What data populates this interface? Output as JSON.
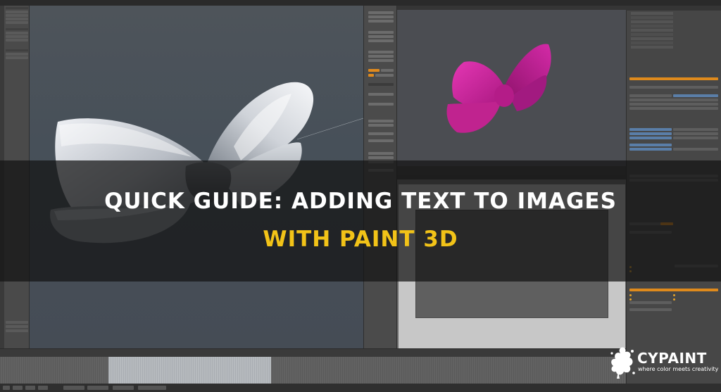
{
  "title": {
    "line1": "QUICK GUIDE: ADDING TEXT TO IMAGES",
    "line2": "WITH PAINT 3D"
  },
  "logo": {
    "name": "CYPAINT",
    "tagline": "where color meets creativity"
  },
  "colors": {
    "title_primary": "#ffffff",
    "title_accent": "#f2c318",
    "bow_left": "#e6e9ee",
    "bow_right": "#c8259b",
    "ui_accent": "#e08a1e"
  },
  "icons": {
    "logo_splash": "paint-splash-icon"
  }
}
